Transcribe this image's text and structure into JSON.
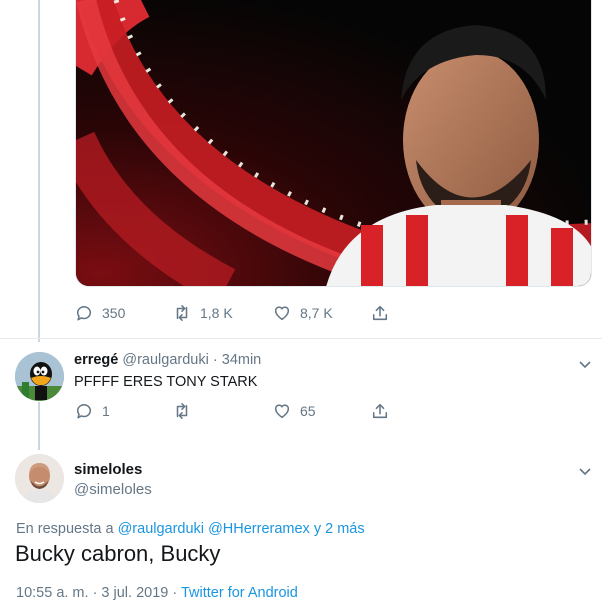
{
  "media_tweet": {
    "image_alt_icon": "photo-player-stadium",
    "stats": {
      "replies": "350",
      "retweets": "1,8 K",
      "likes": "8,7 K"
    }
  },
  "reply_tweet": {
    "display_name": "erregé",
    "handle": "@raulgarduki",
    "separator": "·",
    "time": "34min",
    "text": "PFFFF ERES TONY STARK",
    "stats": {
      "replies": "1",
      "retweets": "",
      "likes": "65"
    }
  },
  "main_tweet": {
    "display_name": "simeloles",
    "handle": "@simeloles",
    "reply_prefix": "En respuesta a",
    "reply_user_1": "@raulgarduki",
    "reply_user_2": "@HHerreramex",
    "reply_suffix": "y 2 más",
    "text": "Bucky cabron, Bucky",
    "timestamp": "10:55 a. m. · 3 jul. 2019 ·",
    "source": "Twitter for Android"
  },
  "colors": {
    "link": "#1b95e0",
    "muted": "#657786",
    "thread_line": "#ccd6dd"
  }
}
